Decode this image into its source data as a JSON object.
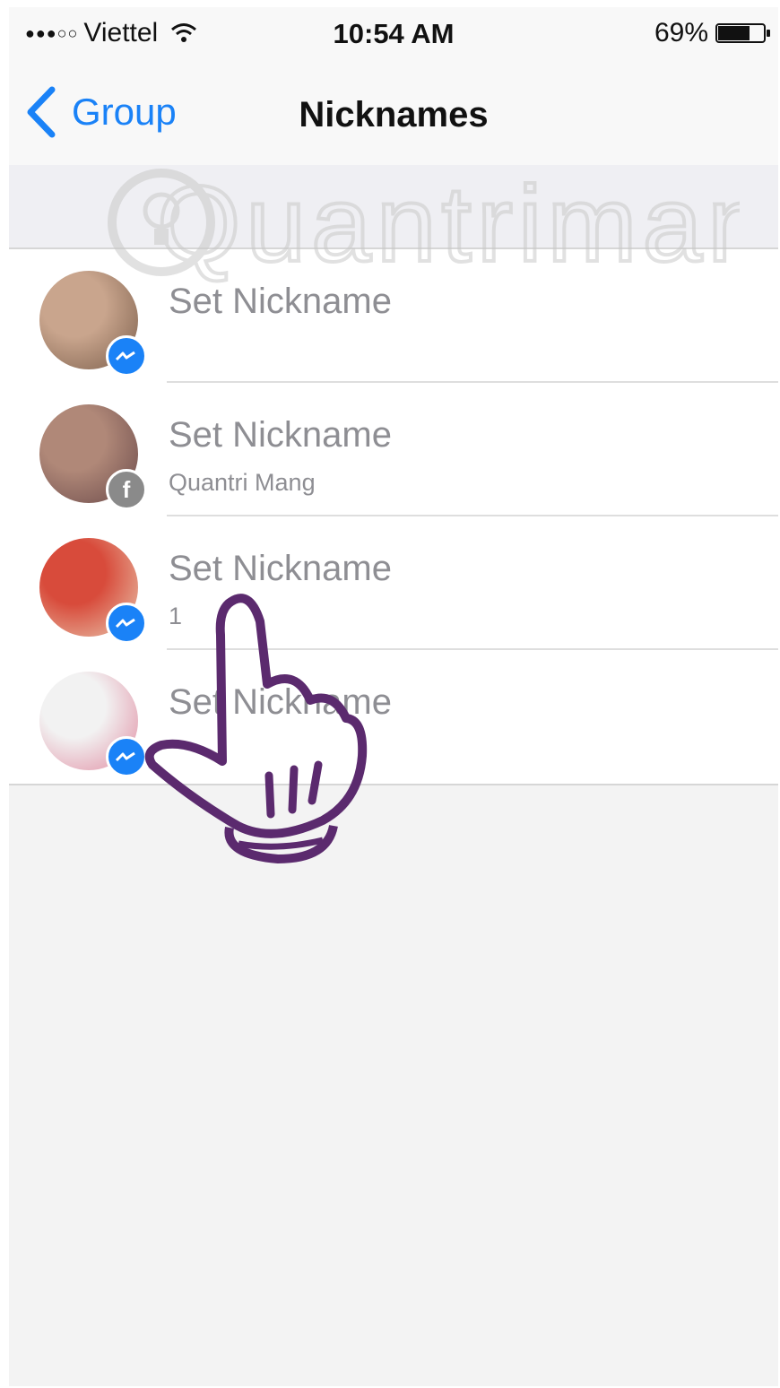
{
  "status_bar": {
    "signal": "●●●○○",
    "carrier": "Viettel",
    "time": "10:54 AM",
    "battery_percent": "69%",
    "battery_level": 0.69
  },
  "nav": {
    "back_label": "Group",
    "title": "Nicknames"
  },
  "watermark_text": "Quantrimang",
  "members": [
    {
      "title": "Set Nickname",
      "subtitle": "",
      "badge": "messenger",
      "avatar_colors": [
        "#c9a58d",
        "#7b5e4b"
      ]
    },
    {
      "title": "Set Nickname",
      "subtitle": "Quantri Mang",
      "badge": "facebook",
      "avatar_colors": [
        "#b08878",
        "#6b4a4a"
      ]
    },
    {
      "title": "Set Nickname",
      "subtitle": "1",
      "badge": "messenger",
      "avatar_colors": [
        "#d84b3b",
        "#e9c9b0"
      ]
    },
    {
      "title": "Set Nickname",
      "subtitle": "",
      "badge": "messenger",
      "avatar_colors": [
        "#f2f2f2",
        "#e08aa0"
      ]
    }
  ],
  "colors": {
    "accent": "#1a82f7",
    "secondary_text": "#8e8e93",
    "hand_stroke": "#5b2a6e"
  }
}
